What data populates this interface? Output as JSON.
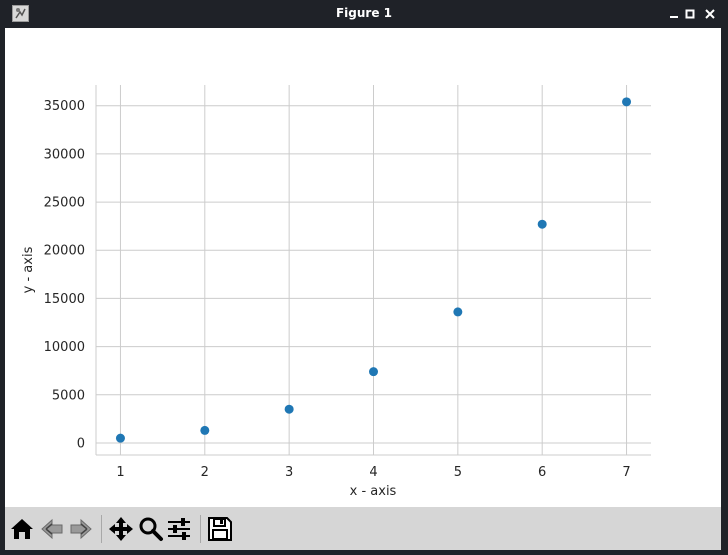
{
  "window": {
    "title": "Figure 1"
  },
  "icons": {
    "app": "matplotlib-figure-icon",
    "minimize": "minimize-icon",
    "maximize": "maximize-icon",
    "close": "close-icon"
  },
  "toolbar": {
    "items": [
      {
        "name": "home-button",
        "icon": "home-icon"
      },
      {
        "name": "back-button",
        "icon": "back-arrow-icon"
      },
      {
        "name": "forward-button",
        "icon": "forward-arrow-icon"
      },
      {
        "name": "pan-button",
        "icon": "move-icon"
      },
      {
        "name": "zoom-button",
        "icon": "zoom-icon"
      },
      {
        "name": "configure-subplots-button",
        "icon": "sliders-icon"
      },
      {
        "name": "save-button",
        "icon": "save-icon"
      }
    ]
  },
  "chart_data": {
    "type": "scatter",
    "title": "",
    "xlabel": "x - axis",
    "ylabel": "y - axis",
    "x": [
      1,
      2,
      3,
      4,
      5,
      6,
      7
    ],
    "y": [
      500,
      1300,
      3500,
      7400,
      13600,
      22700,
      35400
    ],
    "xticks": [
      1,
      2,
      3,
      4,
      5,
      6,
      7
    ],
    "yticks": [
      0,
      5000,
      10000,
      15000,
      20000,
      25000,
      30000,
      35000
    ],
    "xlim": [
      0.71,
      7.29
    ],
    "ylim": [
      -1250,
      37150
    ],
    "grid": true,
    "marker_color": "#1f77b4",
    "grid_color": "#cccccc"
  }
}
